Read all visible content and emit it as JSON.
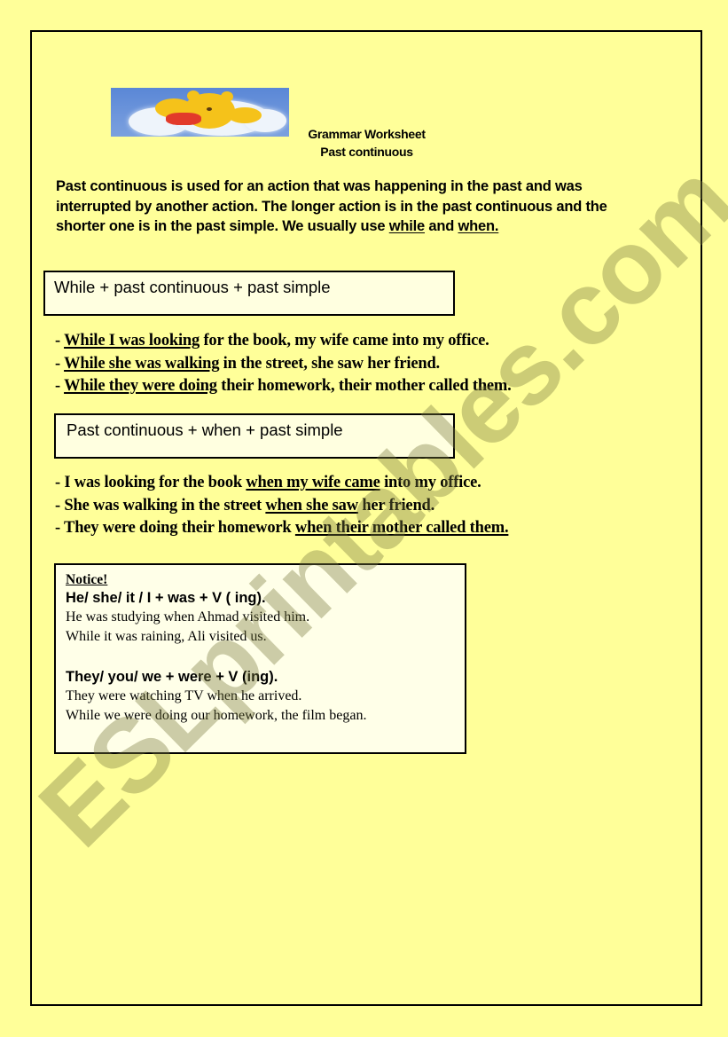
{
  "header": {
    "image": "winnie-the-pooh-on-cloud-illustration",
    "title": "Grammar Worksheet",
    "subtitle": "Past continuous"
  },
  "intro": {
    "text_before": "Past continuous is used for an action that was happening in the past and was interrupted by another action. The longer action is in the past continuous and the shorter one is in the past simple. We usually use ",
    "keyword_1": "while",
    "connector": " and ",
    "keyword_2": "when."
  },
  "section_1": {
    "rule": "While + past continuous + past simple",
    "examples": [
      {
        "prefix": "- ",
        "underlined": "While I was looking",
        "rest": " for the book, my wife came into my office."
      },
      {
        "prefix": "- ",
        "underlined": "While she was walking",
        "rest": " in the street, she saw her friend."
      },
      {
        "prefix": "- ",
        "underlined": "While they were doing",
        "rest": " their homework, their mother called them."
      }
    ]
  },
  "section_2": {
    "rule": "Past continuous + when + past simple",
    "examples": [
      {
        "before": "- I was looking for the book ",
        "underlined": "when my wife came",
        "after": " into my office."
      },
      {
        "before": "- She was walking in the street ",
        "underlined": "when she saw",
        "after": " her friend."
      },
      {
        "before": "- They were doing their homework ",
        "underlined": "when their mother called them.",
        "after": ""
      }
    ]
  },
  "notice": {
    "title": "Notice!",
    "singular_rule": "He/ she/ it / I + was + V ( ing).",
    "singular_examples": [
      "He was studying when Ahmad visited him.",
      "While it was raining, Ali visited us."
    ],
    "plural_rule": "They/ you/ we + were + V (ing).",
    "plural_examples": [
      "They were watching TV when he arrived.",
      "While we were doing our homework, the film began."
    ]
  },
  "watermark": "ESLprintables.com",
  "colors": {
    "page_background": "#ffff99",
    "box_fill": "#ffffe0",
    "border": "#000000"
  }
}
